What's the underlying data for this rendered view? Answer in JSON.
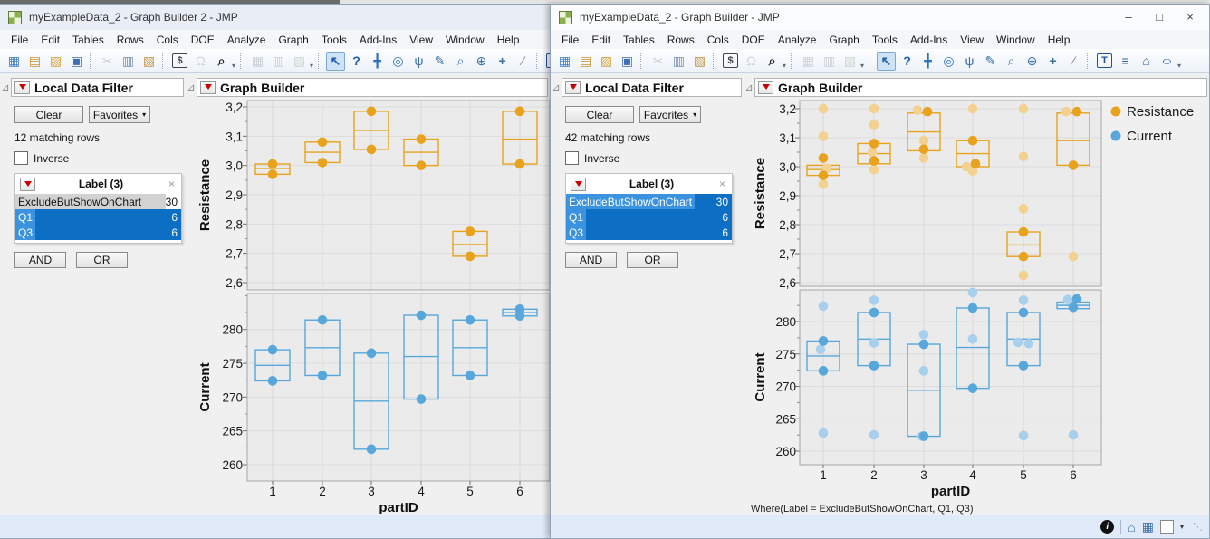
{
  "ui": {
    "disclosure_glyph": "⊿",
    "caret_glyph": "▾",
    "colors": {
      "resistance": "#E8A21C",
      "resistance_faded": "#F2D191",
      "current": "#58A7DB",
      "current_faded": "#A8D0EC",
      "selection": "#0C6FC4",
      "selection_chip": "#3B93E0",
      "plot_bg": "#EBEBEB"
    }
  },
  "menus": [
    "File",
    "Edit",
    "Tables",
    "Rows",
    "Cols",
    "DOE",
    "Analyze",
    "Graph",
    "Tools",
    "Add-Ins",
    "View",
    "Window",
    "Help"
  ],
  "toolbar_icons": [
    {
      "name": "new-data-table-icon",
      "glyph": "▦",
      "color": "#3f7ec2"
    },
    {
      "name": "new-journal-icon",
      "glyph": "▤",
      "color": "#c8912f"
    },
    {
      "name": "open-icon",
      "glyph": "▨",
      "color": "#d9a33a"
    },
    {
      "name": "save-icon",
      "glyph": "▣",
      "color": "#3f6fb5"
    },
    {
      "sep": true
    },
    {
      "name": "cut-icon",
      "glyph": "✂",
      "color": "#8a8f98",
      "dis": true
    },
    {
      "name": "copy-icon",
      "glyph": "▥",
      "color": "#7a94b8"
    },
    {
      "name": "paste-icon",
      "glyph": "▧",
      "color": "#c09a4a"
    },
    {
      "sep": true
    },
    {
      "name": "preferences-icon",
      "glyph": "$",
      "color": "#444444",
      "box": true
    },
    {
      "name": "lock-icon",
      "glyph": "Ω",
      "color": "#9aa0a8",
      "dis": true
    },
    {
      "name": "search-icon",
      "glyph": "⌕",
      "color": "#222222",
      "bold": true
    },
    {
      "caret": true
    },
    {
      "sep": true
    },
    {
      "name": "table-panel-icon",
      "glyph": "▦",
      "color": "#8a94a0",
      "dis": true
    },
    {
      "name": "table-cols-icon",
      "glyph": "▥",
      "color": "#8a94a0",
      "dis": true
    },
    {
      "name": "table-add-icon",
      "glyph": "▧",
      "color": "#8aa486",
      "dis": true
    },
    {
      "caret": true
    },
    {
      "sep": true
    },
    {
      "name": "arrow-tool-icon",
      "glyph": "↖",
      "color": "#1f5fae",
      "sel": true,
      "bold": true
    },
    {
      "name": "help-tool-icon",
      "glyph": "?",
      "color": "#1f5fae",
      "bold": true
    },
    {
      "name": "move-tool-icon",
      "glyph": "╋",
      "color": "#2f6fbf"
    },
    {
      "name": "target-tool-icon",
      "glyph": "◎",
      "color": "#2f6fbf"
    },
    {
      "name": "hand-tool-icon",
      "glyph": "ψ",
      "color": "#3a6ea5"
    },
    {
      "name": "brush-tool-icon",
      "glyph": "✎",
      "color": "#3a6ea5"
    },
    {
      "name": "lasso-tool-icon",
      "glyph": "⌕",
      "color": "#3a6ea5"
    },
    {
      "name": "zoom-tool-icon",
      "glyph": "⊕",
      "color": "#3a6ea5"
    },
    {
      "name": "crosshair-tool-icon",
      "glyph": "+",
      "color": "#3a6ea5",
      "bold": true
    },
    {
      "name": "annotate-tool-icon",
      "glyph": "∕",
      "color": "#888888"
    },
    {
      "sep": true
    },
    {
      "name": "text-box-tool-icon",
      "glyph": "T",
      "color": "#1f4f9e",
      "box": true
    },
    {
      "name": "line-tool-icon",
      "glyph": "≡",
      "color": "#2f5fae"
    },
    {
      "name": "polygon-tool-icon",
      "glyph": "⌂",
      "color": "#2f5fae"
    },
    {
      "name": "oval-tool-icon",
      "glyph": "○",
      "color": "#2f5fae",
      "stretch": true
    },
    {
      "caret": true
    }
  ],
  "statusbar_icons": [
    {
      "name": "info-icon",
      "glyph": "i",
      "cls": "sb-info"
    },
    {
      "name": "statusbar-separator",
      "glyph": "",
      "cls": "sb-sep"
    },
    {
      "name": "home-icon",
      "glyph": "⌂",
      "cls": "sb-ic"
    },
    {
      "name": "data-table-edit-icon",
      "glyph": "▦",
      "cls": "sb-ic"
    },
    {
      "name": "color-swatch",
      "glyph": "",
      "cls": "sb-swatch"
    },
    {
      "name": "dropdown-caret-icon",
      "glyph": "▾",
      "cls": "sb-caret"
    },
    {
      "name": "resize-grip-icon",
      "glyph": "⋱",
      "cls": "sb-grip"
    }
  ],
  "windows": [
    {
      "title": "myExampleData_2 - Graph Builder 2 - JMP",
      "filter": {
        "title": "Local Data Filter",
        "clear_label": "Clear",
        "favorites_label": "Favorites",
        "matching_text": "12 matching rows",
        "inverse_label": "Inverse",
        "list_title": "Label (3)",
        "close_glyph": "×",
        "rows": [
          {
            "label": "ExcludeButShowOnChart",
            "count": "30",
            "selected": false
          },
          {
            "label": "Q1",
            "count": "6",
            "selected": true
          },
          {
            "label": "Q3",
            "count": "6",
            "selected": true
          }
        ],
        "and_label": "AND",
        "or_label": "OR"
      },
      "graph_title": "Graph Builder"
    },
    {
      "title": "myExampleData_2 - Graph Builder - JMP",
      "controls": [
        {
          "name": "minimize-button",
          "glyph": "–"
        },
        {
          "name": "maximize-button",
          "glyph": "□"
        },
        {
          "name": "close-button",
          "glyph": "×"
        }
      ],
      "filter": {
        "title": "Local Data Filter",
        "clear_label": "Clear",
        "favorites_label": "Favorites",
        "matching_text": "42 matching rows",
        "inverse_label": "Inverse",
        "list_title": "Label (3)",
        "close_glyph": "×",
        "rows": [
          {
            "label": "ExcludeButShowOnChart",
            "count": "30",
            "selected": true
          },
          {
            "label": "Q1",
            "count": "6",
            "selected": true
          },
          {
            "label": "Q3",
            "count": "6",
            "selected": true
          }
        ],
        "and_label": "AND",
        "or_label": "OR"
      },
      "graph_title": "Graph Builder"
    }
  ],
  "chart_data": [
    {
      "type": "boxplot-scatter",
      "title": "Graph Builder",
      "xlabel": "partID",
      "categories": [
        "1",
        "2",
        "3",
        "4",
        "5",
        "6"
      ],
      "panels": [
        {
          "ylabel": "Resistance",
          "color": "#E8A21C",
          "faded_color": "#F2D191",
          "ylim": [
            2.55,
            3.22
          ],
          "yticks": [
            {
              "v": 3.2,
              "label": "3,2"
            },
            {
              "v": 3.1,
              "label": "3,1"
            },
            {
              "v": 3.0,
              "label": "3,0"
            },
            {
              "v": 2.9,
              "label": "2,9"
            },
            {
              "v": 2.8,
              "label": "2,8"
            },
            {
              "v": 2.7,
              "label": "2,7"
            },
            {
              "v": 2.6,
              "label": "2,6"
            }
          ],
          "boxes": [
            {
              "lo": 2.97,
              "hi": 3.005,
              "med": 2.99
            },
            {
              "lo": 3.01,
              "hi": 3.08,
              "med": 3.045
            },
            {
              "lo": 3.055,
              "hi": 3.185,
              "med": 3.12
            },
            {
              "lo": 3.0,
              "hi": 3.09,
              "med": 3.045
            },
            {
              "lo": 2.69,
              "hi": 2.775,
              "med": 2.73
            },
            {
              "lo": 3.005,
              "hi": 3.185,
              "med": 3.09
            }
          ],
          "points": [
            [
              [
                3.005
              ],
              [
                2.97
              ]
            ],
            [
              [
                3.08
              ],
              [
                3.01
              ]
            ],
            [
              [
                3.185
              ],
              [
                3.055
              ]
            ],
            [
              [
                3.09
              ],
              [
                3.0
              ]
            ],
            [
              [
                2.775
              ],
              [
                2.69
              ]
            ],
            [
              [
                3.185
              ],
              [
                3.005
              ]
            ]
          ]
        },
        {
          "ylabel": "Current",
          "color": "#58A7DB",
          "faded_color": "#A8D0EC",
          "ylim": [
            257,
            285
          ],
          "yticks": [
            {
              "v": 280,
              "label": "280"
            },
            {
              "v": 275,
              "label": "275"
            },
            {
              "v": 270,
              "label": "270"
            },
            {
              "v": 265,
              "label": "265"
            },
            {
              "v": 260,
              "label": "260"
            }
          ],
          "boxes": [
            {
              "lo": 272.4,
              "hi": 277.0,
              "med": 274.7
            },
            {
              "lo": 273.2,
              "hi": 281.4,
              "med": 277.3
            },
            {
              "lo": 262.3,
              "hi": 276.5,
              "med": 269.4
            },
            {
              "lo": 269.7,
              "hi": 282.1,
              "med": 276.0
            },
            {
              "lo": 273.2,
              "hi": 281.4,
              "med": 277.3
            },
            {
              "lo": 282.0,
              "hi": 283.0,
              "med": 282.5
            }
          ],
          "points": [
            [
              [
                277.0
              ],
              [
                272.4
              ]
            ],
            [
              [
                281.4
              ],
              [
                273.2
              ]
            ],
            [
              [
                276.5
              ],
              [
                262.3
              ]
            ],
            [
              [
                282.1
              ],
              [
                269.7
              ]
            ],
            [
              [
                281.4
              ],
              [
                273.2
              ]
            ],
            [
              [
                283.0
              ],
              [
                282.0
              ]
            ]
          ]
        }
      ]
    },
    {
      "type": "boxplot-scatter",
      "title": "Graph Builder",
      "xlabel": "partID",
      "categories": [
        "1",
        "2",
        "3",
        "4",
        "5",
        "6"
      ],
      "legend": [
        {
          "label": "Resistance",
          "color": "#E8A21C"
        },
        {
          "label": "Current",
          "color": "#58A7DB"
        }
      ],
      "where_note": "Where(Label = ExcludeButShowOnChart, Q1, Q3)",
      "panels": [
        {
          "ylabel": "Resistance",
          "color": "#E8A21C",
          "faded_color": "#F2D191",
          "ylim": [
            2.55,
            3.22
          ],
          "yticks": [
            {
              "v": 3.2,
              "label": "3,2"
            },
            {
              "v": 3.1,
              "label": "3,1"
            },
            {
              "v": 3.0,
              "label": "3,0"
            },
            {
              "v": 2.9,
              "label": "2,9"
            },
            {
              "v": 2.8,
              "label": "2,8"
            },
            {
              "v": 2.7,
              "label": "2,7"
            },
            {
              "v": 2.6,
              "label": "2,6"
            }
          ],
          "boxes": [
            {
              "lo": 2.97,
              "hi": 3.005,
              "med": 2.99
            },
            {
              "lo": 3.01,
              "hi": 3.08,
              "med": 3.045
            },
            {
              "lo": 3.055,
              "hi": 3.185,
              "med": 3.12
            },
            {
              "lo": 3.0,
              "hi": 3.09,
              "med": 3.045
            },
            {
              "lo": 2.69,
              "hi": 2.775,
              "med": 2.73
            },
            {
              "lo": 3.005,
              "hi": 3.185,
              "med": 3.09
            }
          ],
          "points": [
            [
              [
                3.03
              ],
              [
                2.97
              ]
            ],
            [
              [
                3.08
              ],
              [
                3.02
              ]
            ],
            [
              [
                3.19,
                4
              ],
              [
                3.06
              ]
            ],
            [
              [
                3.09
              ],
              [
                3.01,
                3
              ]
            ],
            [
              [
                2.775
              ],
              [
                2.69
              ]
            ],
            [
              [
                3.19,
                4
              ],
              [
                3.005
              ]
            ]
          ],
          "faded_points": [
            [
              [
                3.2
              ],
              [
                3.105
              ],
              [
                2.995,
                4
              ],
              [
                2.94
              ]
            ],
            [
              [
                3.2
              ],
              [
                3.145
              ],
              [
                3.05,
                -2
              ],
              [
                2.99
              ]
            ],
            [
              [
                3.195,
                -7
              ],
              [
                3.09
              ],
              [
                3.03
              ]
            ],
            [
              [
                3.2
              ],
              [
                3.0,
                -7
              ],
              [
                2.985
              ]
            ],
            [
              [
                3.2
              ],
              [
                3.035
              ],
              [
                2.855
              ],
              [
                2.625
              ]
            ],
            [
              [
                3.19,
                -8
              ],
              [
                2.69
              ]
            ]
          ]
        },
        {
          "ylabel": "Current",
          "color": "#58A7DB",
          "faded_color": "#A8D0EC",
          "ylim": [
            257,
            285
          ],
          "yticks": [
            {
              "v": 280,
              "label": "280"
            },
            {
              "v": 275,
              "label": "275"
            },
            {
              "v": 270,
              "label": "270"
            },
            {
              "v": 265,
              "label": "265"
            },
            {
              "v": 260,
              "label": "260"
            }
          ],
          "boxes": [
            {
              "lo": 272.4,
              "hi": 277.0,
              "med": 274.7
            },
            {
              "lo": 273.2,
              "hi": 281.4,
              "med": 277.3
            },
            {
              "lo": 262.3,
              "hi": 276.5,
              "med": 269.4
            },
            {
              "lo": 269.7,
              "hi": 282.1,
              "med": 276.0
            },
            {
              "lo": 273.2,
              "hi": 281.4,
              "med": 277.3
            },
            {
              "lo": 282.0,
              "hi": 283.0,
              "med": 282.5
            }
          ],
          "points": [
            [
              [
                277.0
              ],
              [
                272.4
              ]
            ],
            [
              [
                281.4
              ],
              [
                273.2
              ]
            ],
            [
              [
                276.5
              ],
              [
                262.3
              ]
            ],
            [
              [
                282.1
              ],
              [
                269.7
              ]
            ],
            [
              [
                281.4
              ],
              [
                273.2
              ]
            ],
            [
              [
                283.5,
                4
              ],
              [
                282.2
              ]
            ]
          ],
          "faded_points": [
            [
              [
                282.4
              ],
              [
                275.7,
                -3
              ],
              [
                262.8
              ]
            ],
            [
              [
                283.3
              ],
              [
                276.7
              ],
              [
                262.5
              ]
            ],
            [
              [
                278.0
              ],
              [
                272.4
              ],
              [
                262.3,
                -2
              ]
            ],
            [
              [
                284.5
              ],
              [
                277.3
              ]
            ],
            [
              [
                283.3
              ],
              [
                276.8,
                -6
              ],
              [
                276.6,
                6
              ],
              [
                262.4
              ]
            ],
            [
              [
                283.4,
                -6
              ],
              [
                262.5
              ]
            ]
          ]
        }
      ]
    }
  ]
}
